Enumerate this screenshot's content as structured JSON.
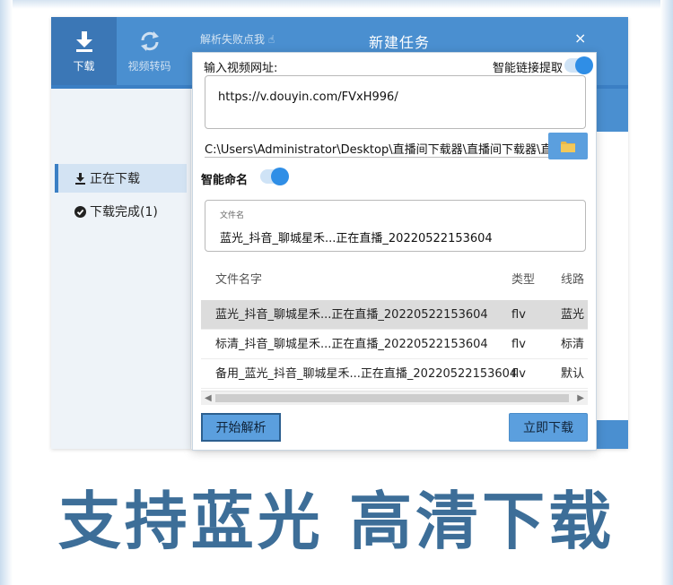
{
  "app": {
    "nav": {
      "download_label": "下载",
      "convert_label": "视频转码"
    },
    "parse_fail_label": "解析失败点我",
    "sidebar": {
      "items": [
        {
          "label": "正在下载",
          "icon": "download-icon",
          "active": true
        },
        {
          "label": "下载完成(1)",
          "icon": "check-circle-icon",
          "active": false
        }
      ]
    }
  },
  "dialog": {
    "title": "新建任务",
    "close_glyph": "×",
    "url_label": "输入视频网址:",
    "smart_link_label": "智能链接提取",
    "smart_link_on": true,
    "url_value": "https://v.douyin.com/FVxH996/",
    "save_path": "C:\\Users\\Administrator\\Desktop\\直播间下载器\\直播间下载器\\直播间下载",
    "smart_naming_label": "智能命名",
    "smart_naming_on": true,
    "filename_caption": "文件名",
    "filename_value": "蓝光_抖音_聊城星禾...正在直播_20220522153604",
    "table": {
      "headers": {
        "name": "文件名字",
        "type": "类型",
        "line": "线路"
      },
      "rows": [
        {
          "name": "蓝光_抖音_聊城星禾...正在直播_20220522153604",
          "type": "flv",
          "line": "蓝光",
          "selected": true
        },
        {
          "name": "标清_抖音_聊城星禾...正在直播_20220522153604",
          "type": "flv",
          "line": "标清",
          "selected": false
        },
        {
          "name": "备用_蓝光_抖音_聊城星禾...正在直播_20220522153604",
          "type": "flv",
          "line": "默认",
          "selected": false
        }
      ]
    },
    "parse_button": "开始解析",
    "download_button": "立即下载"
  },
  "headline": "支持蓝光 高清下载",
  "colors": {
    "header_blue": "#4a8fd0",
    "button_blue": "#5b9fde",
    "headline_blue": "#3d6e98",
    "toggle_blue": "#2f8ee6"
  }
}
